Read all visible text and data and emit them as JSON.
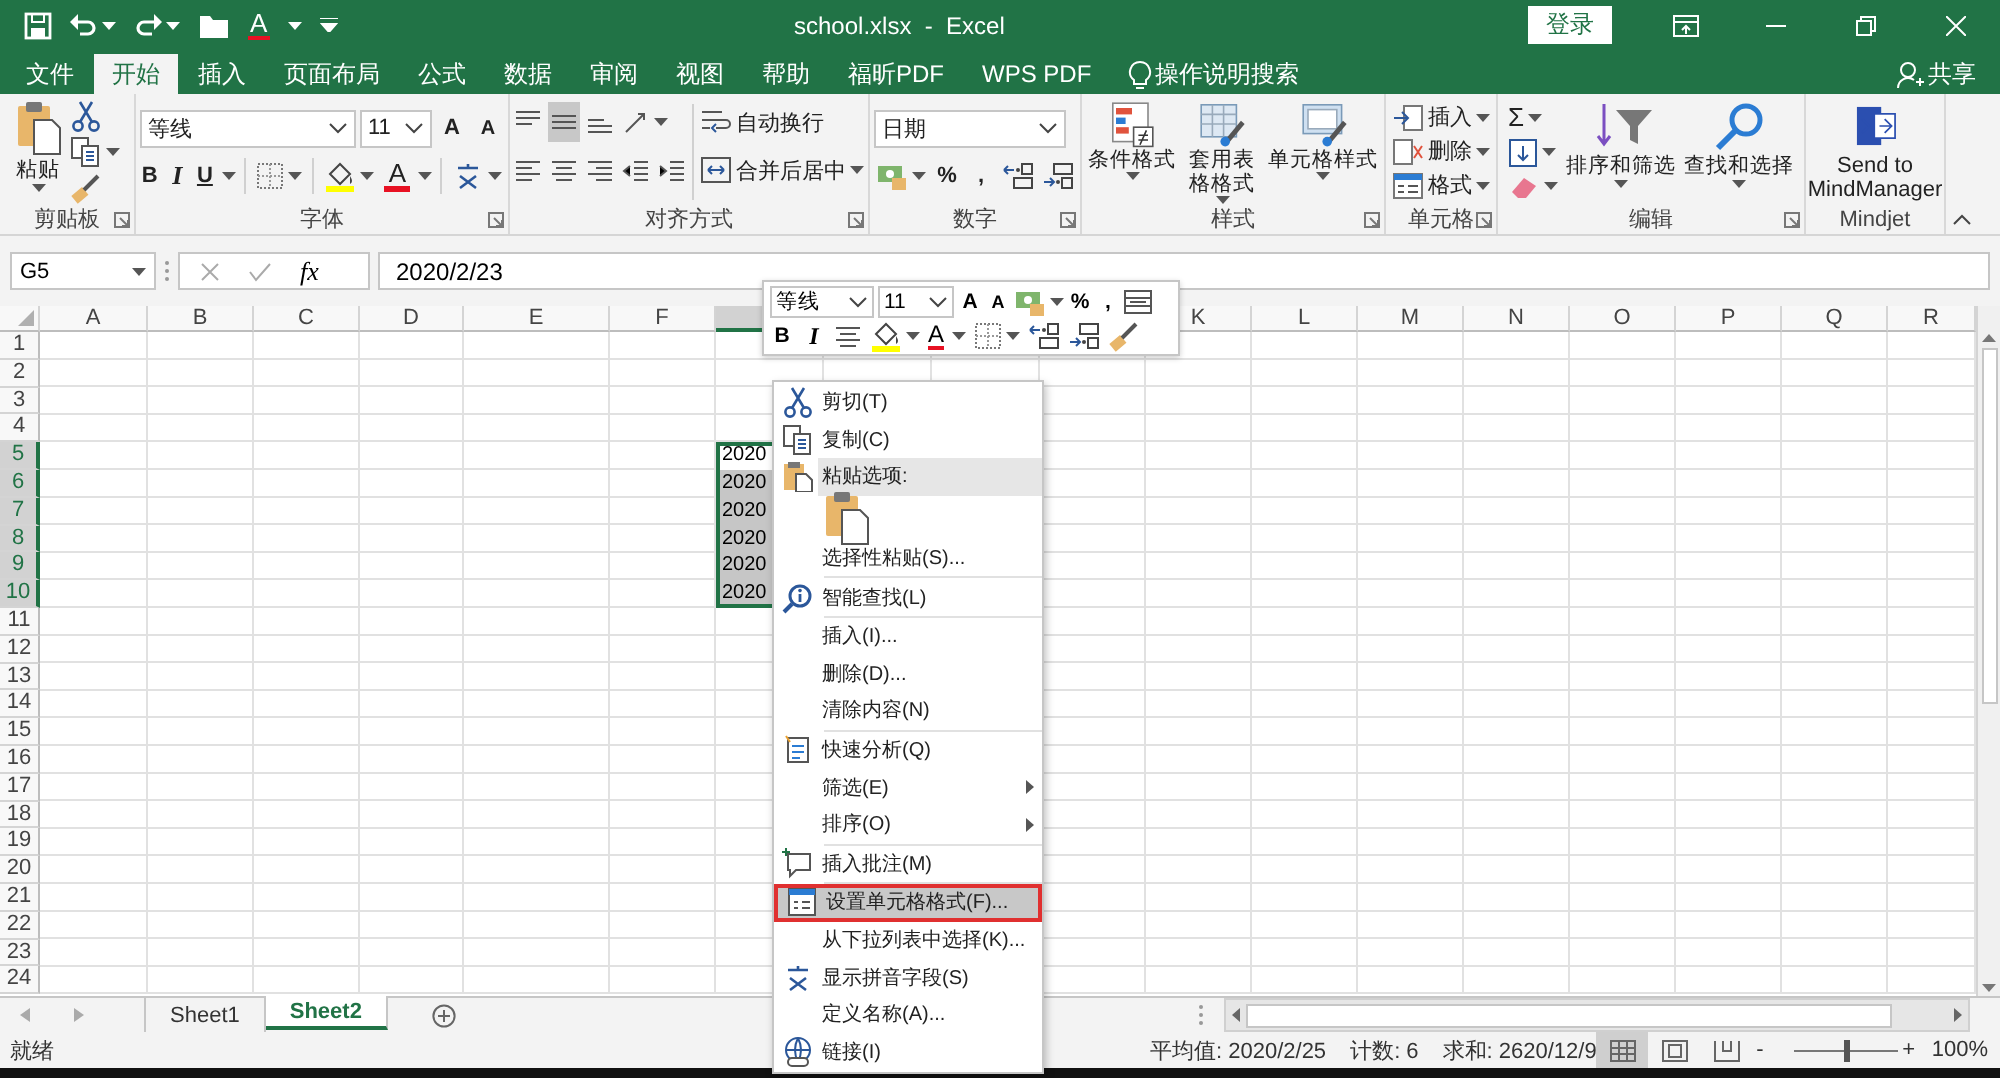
{
  "title_bar": {
    "title": "school.xlsx  -  Excel",
    "font_color": "A",
    "sign_in": "登录"
  },
  "ribbon_tabs": [
    {
      "label": "文件",
      "selected": false
    },
    {
      "label": "开始",
      "selected": true
    },
    {
      "label": "插入",
      "selected": false
    },
    {
      "label": "页面布局",
      "selected": false
    },
    {
      "label": "公式",
      "selected": false
    },
    {
      "label": "数据",
      "selected": false
    },
    {
      "label": "审阅",
      "selected": false
    },
    {
      "label": "视图",
      "selected": false
    },
    {
      "label": "帮助",
      "selected": false
    },
    {
      "label": "福昕PDF",
      "selected": false
    },
    {
      "label": "WPS PDF",
      "selected": false
    }
  ],
  "tell_me": "操作说明搜索",
  "share": "共享",
  "ribbon": {
    "clipboard": {
      "label": "剪贴板",
      "paste": "粘贴"
    },
    "font": {
      "label": "字体",
      "font_name": "等线",
      "font_size": "11",
      "grow": "A",
      "shrink": "A",
      "bold": "B",
      "italic": "I",
      "underline": "U",
      "font_color": "A"
    },
    "alignment": {
      "label": "对齐方式",
      "wrap_text": "自动换行",
      "merge_center": "合并后居中"
    },
    "number": {
      "label": "数字",
      "format": "日期",
      "percent": "%",
      "comma": ","
    },
    "styles": {
      "label": "样式",
      "buttons": [
        "条件格式",
        "套用表格格式",
        "单元格样式"
      ]
    },
    "cells": {
      "label": "单元格",
      "buttons": [
        "插入",
        "删除",
        "格式"
      ]
    },
    "editing": {
      "label": "编辑",
      "autosum": "Σ",
      "sort_filter": "排序和筛选",
      "find_select": "查找和选择"
    },
    "mindjet": {
      "label": "Mindjet",
      "button": "Send to\nMindManager"
    }
  },
  "formula_bar": {
    "name_box": "G5",
    "function_label": "fx",
    "value": "2020/2/23"
  },
  "sheet": {
    "columns": [
      {
        "label": "A",
        "selected": false
      },
      {
        "label": "B",
        "selected": false
      },
      {
        "label": "C",
        "selected": false
      },
      {
        "label": "D",
        "selected": false
      },
      {
        "label": "E",
        "selected": false
      },
      {
        "label": "F",
        "selected": false
      },
      {
        "selected": true
      },
      {},
      {},
      {},
      {
        "label": "K",
        "selected": false
      },
      {
        "label": "L",
        "selected": false
      },
      {
        "label": "M",
        "selected": false
      },
      {
        "label": "N",
        "selected": false
      },
      {
        "label": "O",
        "selected": false
      },
      {
        "label": "P",
        "selected": false
      },
      {
        "label": "Q",
        "selected": false
      },
      {
        "label": "R",
        "selected": false
      }
    ],
    "rows": [
      {
        "label": "1",
        "selected": false
      },
      {
        "label": "2",
        "selected": false
      },
      {
        "label": "3",
        "selected": false
      },
      {
        "label": "4",
        "selected": false
      },
      {
        "label": "5",
        "selected": true,
        "selection_cell": {
          "text": "2020",
          "active": true
        }
      },
      {
        "label": "6",
        "selected": true,
        "selection_cell": {
          "text": "2020",
          "active": false
        }
      },
      {
        "label": "7",
        "selected": true,
        "selection_cell": {
          "text": "2020",
          "active": false
        }
      },
      {
        "label": "8",
        "selected": true,
        "selection_cell": {
          "text": "2020",
          "active": false
        }
      },
      {
        "label": "9",
        "selected": true,
        "selection_cell": {
          "text": "2020",
          "active": false
        }
      },
      {
        "label": "10",
        "selected": true,
        "selection_cell": {
          "text": "2020",
          "active": false
        }
      },
      {
        "label": "11",
        "selected": false
      },
      {
        "label": "12",
        "selected": false
      },
      {
        "label": "13",
        "selected": false
      },
      {
        "label": "14",
        "selected": false
      },
      {
        "label": "15",
        "selected": false
      },
      {
        "label": "16",
        "selected": false
      },
      {
        "label": "17",
        "selected": false
      },
      {
        "label": "18",
        "selected": false
      },
      {
        "label": "19",
        "selected": false
      },
      {
        "label": "20",
        "selected": false
      },
      {
        "label": "21",
        "selected": false
      },
      {
        "label": "22",
        "selected": false
      },
      {
        "label": "23",
        "selected": false
      },
      {
        "label": "24",
        "selected": false
      }
    ]
  },
  "sheet_tabs": [
    {
      "label": "Sheet1",
      "selected": false
    },
    {
      "label": "Sheet2",
      "selected": true
    }
  ],
  "status_bar": {
    "ready": "就绪",
    "average": "平均值: 2020/2/25",
    "count": "计数: 6",
    "sum": "求和: 2620/12/9",
    "views": [
      {
        "kind": "normal",
        "selected": true
      },
      {
        "kind": "page-layout",
        "selected": false
      },
      {
        "kind": "page-break",
        "selected": false
      }
    ],
    "zoom_out": "-",
    "zoom_slider": {
      "level": 0.5
    },
    "zoom_in": "+",
    "zoom": "100%"
  },
  "mini_toolbar": {
    "font_name": "等线",
    "font_size": "11",
    "grow": "A",
    "shrink": "A",
    "percent": "%",
    "comma": ",",
    "bold": "B",
    "italic": "I",
    "font_color": "A"
  },
  "context_menu": {
    "items": [
      {
        "kind": "item",
        "label": "剪切(T)",
        "selected": false,
        "separator_after": false,
        "outlined": false
      },
      {
        "kind": "item",
        "label": "复制(C)",
        "selected": false,
        "separator_after": false,
        "outlined": false
      },
      {
        "kind": "header",
        "label": "粘贴选项:",
        "selected": false,
        "separator_after": false,
        "outlined": false
      },
      {
        "kind": "paste-option",
        "selected": false,
        "separator_after": false,
        "outlined": false
      },
      {
        "kind": "item",
        "label": "选择性粘贴(S)...",
        "selected": false,
        "separator_after": true,
        "outlined": false
      },
      {
        "kind": "item",
        "label": "智能查找(L)",
        "selected": false,
        "separator_after": true,
        "outlined": false
      },
      {
        "kind": "item",
        "label": "插入(I)...",
        "selected": false,
        "separator_after": false,
        "outlined": false
      },
      {
        "kind": "item",
        "label": "删除(D)...",
        "selected": false,
        "separator_after": false,
        "outlined": false
      },
      {
        "kind": "item",
        "label": "清除内容(N)",
        "selected": false,
        "separator_after": true,
        "outlined": false
      },
      {
        "kind": "item",
        "label": "快速分析(Q)",
        "selected": false,
        "separator_after": false,
        "outlined": false
      },
      {
        "kind": "submenu",
        "label": "筛选(E)",
        "selected": false,
        "separator_after": false,
        "outlined": false
      },
      {
        "kind": "submenu",
        "label": "排序(O)",
        "selected": false,
        "separator_after": true,
        "outlined": false
      },
      {
        "kind": "item",
        "label": "插入批注(M)",
        "selected": false,
        "separator_after": true,
        "outlined": false
      },
      {
        "kind": "item",
        "label": "设置单元格格式(F)...",
        "selected": true,
        "separator_after": false,
        "outlined": true
      },
      {
        "kind": "item",
        "label": "从下拉列表中选择(K)...",
        "selected": false,
        "separator_after": false,
        "outlined": false
      },
      {
        "kind": "item",
        "label": "显示拼音字段(S)",
        "selected": false,
        "separator_after": false,
        "outlined": false
      },
      {
        "kind": "item",
        "label": "定义名称(A)...",
        "selected": false,
        "separator_after": false,
        "outlined": false
      },
      {
        "kind": "item",
        "label": "链接(I)",
        "selected": false,
        "separator_after": false,
        "outlined": false
      }
    ]
  }
}
